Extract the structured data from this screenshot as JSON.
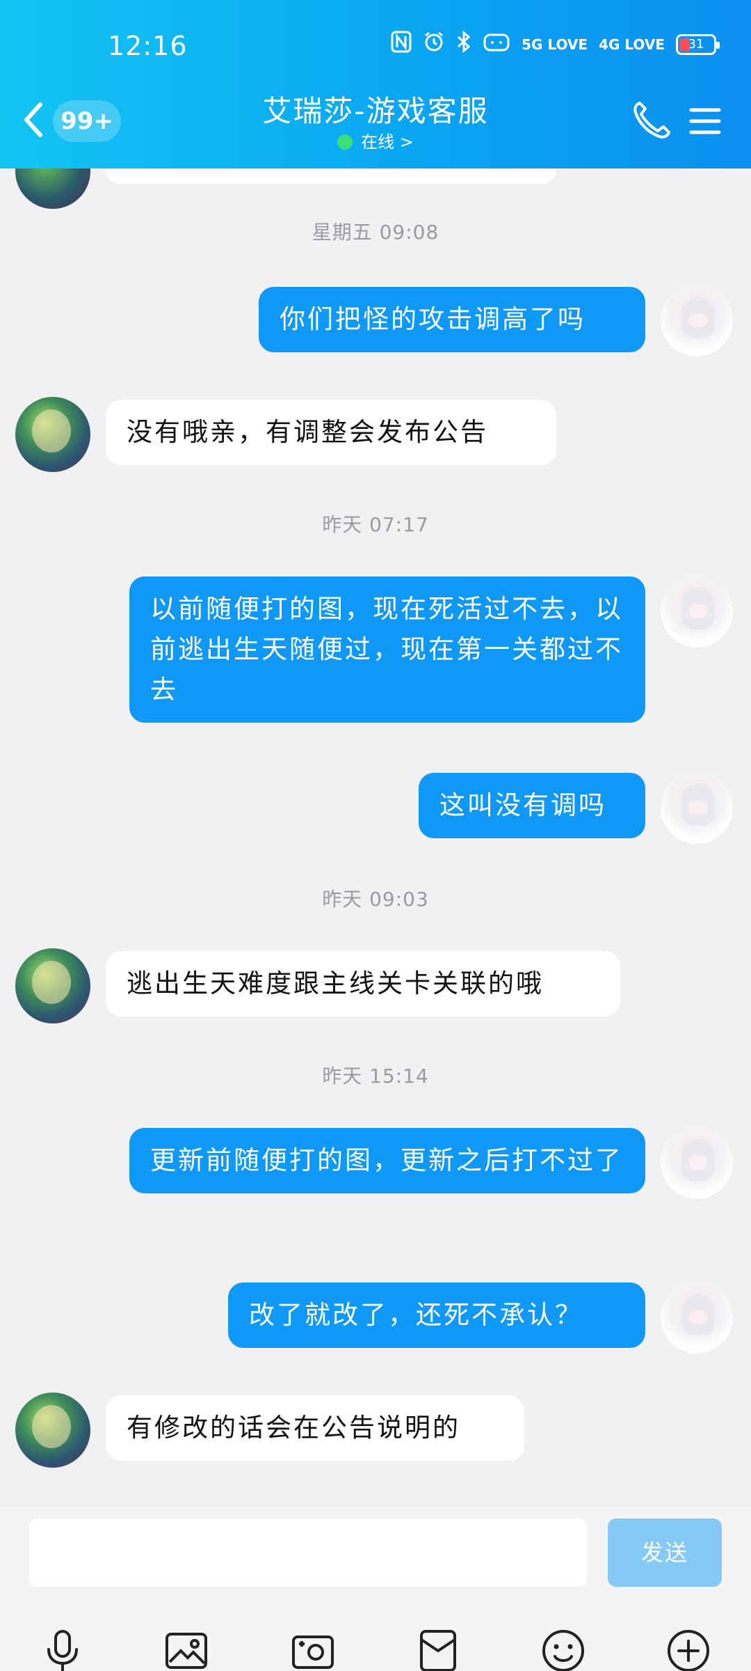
{
  "status_bar": {
    "time": "12:16",
    "net_5g": "5G LOVE",
    "net_4g": "4G LOVE",
    "battery": "31"
  },
  "header": {
    "back_count": "99+",
    "title": "艾瑞莎-游戏客服",
    "online_label": "在线 >"
  },
  "messages": [
    {
      "type": "timestamp",
      "text": "星期五 09:08"
    },
    {
      "type": "out",
      "text": "你们把怪的攻击调高了吗"
    },
    {
      "type": "in",
      "text": "没有哦亲，有调整会发布公告"
    },
    {
      "type": "timestamp",
      "text": "昨天 07:17"
    },
    {
      "type": "out",
      "text": "以前随便打的图，现在死活过不去，以前逃出生天随便过，现在第一关都过不去"
    },
    {
      "type": "out",
      "text": "这叫没有调吗"
    },
    {
      "type": "timestamp",
      "text": "昨天 09:03"
    },
    {
      "type": "in",
      "text": "逃出生天难度跟主线关卡关联的哦"
    },
    {
      "type": "timestamp",
      "text": "昨天 15:14"
    },
    {
      "type": "out",
      "text": "更新前随便打的图，更新之后打不过了"
    },
    {
      "type": "out",
      "text": "改了就改了，还死不承认？"
    },
    {
      "type": "in",
      "text": "有修改的话会在公告说明的"
    }
  ],
  "input": {
    "placeholder": "",
    "send_label": "发送"
  },
  "toolbar": [
    "microphone-icon",
    "image-icon",
    "camera-icon",
    "file-icon",
    "emoji-icon",
    "plus-icon"
  ],
  "colors": {
    "header_start": "#13c4f3",
    "header_end": "#0b8ff0",
    "out_bubble": "#0f98f5",
    "in_bubble": "#ffffff",
    "send_disabled": "#85c9f7",
    "online_dot": "#39e07a"
  }
}
